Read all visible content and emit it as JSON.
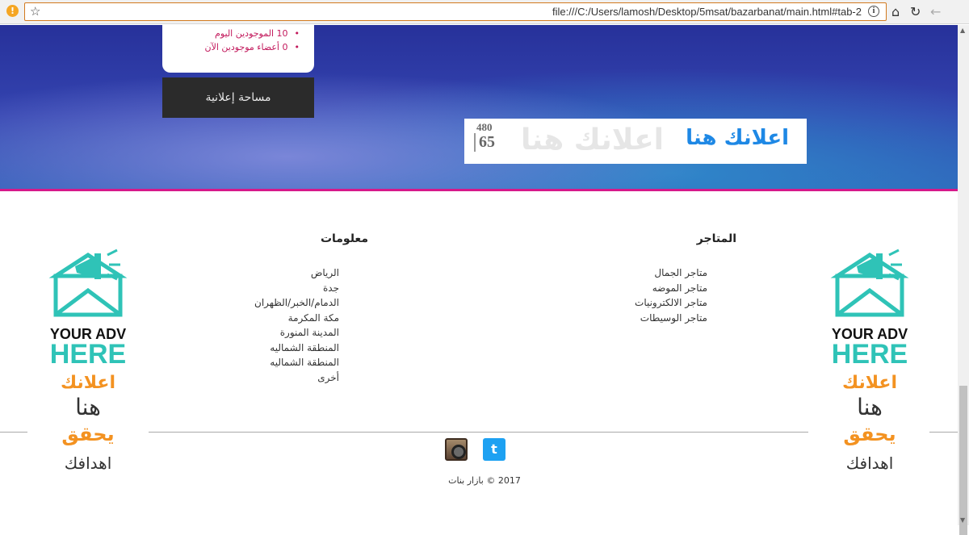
{
  "browser": {
    "url": "file:///C:/Users/lamosh/Desktop/5msat/bazarbanat/main.html#tab-2",
    "warning_glyph": "!",
    "bookmark_glyph": "☆",
    "info_glyph": "i",
    "home_glyph": "⌂",
    "reload_glyph": "↻",
    "back_glyph": "←"
  },
  "stats": {
    "items": [
      "10 الموجودين اليوم",
      "0 أعضاء موجودين الآن"
    ]
  },
  "ad_space": {
    "label": "مساحة إعلانية"
  },
  "ad_banner": {
    "size_w": "480",
    "size_h": "65",
    "ghost_text": "اعلانك هنا",
    "main_text": "اعلانك هنا"
  },
  "footer": {
    "info": {
      "title": "معلومات",
      "items": [
        "الرياض",
        "جدة",
        "الدمام/الخبر/الظهران",
        "مكة المكرمة",
        "المدينة المنورة",
        "المنطقة الشماليه",
        "المنطقة الشماليه",
        "أخرى"
      ]
    },
    "stores": {
      "title": "المتاجر",
      "items": [
        "متاجر الجمال",
        "متاجر الموضه",
        "متاجر الالكترونيات",
        "متاجر الوسيطات"
      ]
    },
    "twitter_glyph": "t",
    "copyright": "2017 © بازار بنات"
  },
  "side_ad": {
    "line1": "YOUR ADV",
    "line2": "HERE",
    "line3": "اعلانك",
    "line4": "هنا",
    "line5": "يحقق",
    "line6": "اهدافك"
  },
  "colors": {
    "accent_pink": "#d6198a",
    "teal": "#2fc3b7",
    "orange": "#f39221",
    "twitter": "#1da1f2",
    "banner_blue": "#27319a"
  },
  "scrollbar": {
    "up_glyph": "▲",
    "down_glyph": "▼"
  }
}
